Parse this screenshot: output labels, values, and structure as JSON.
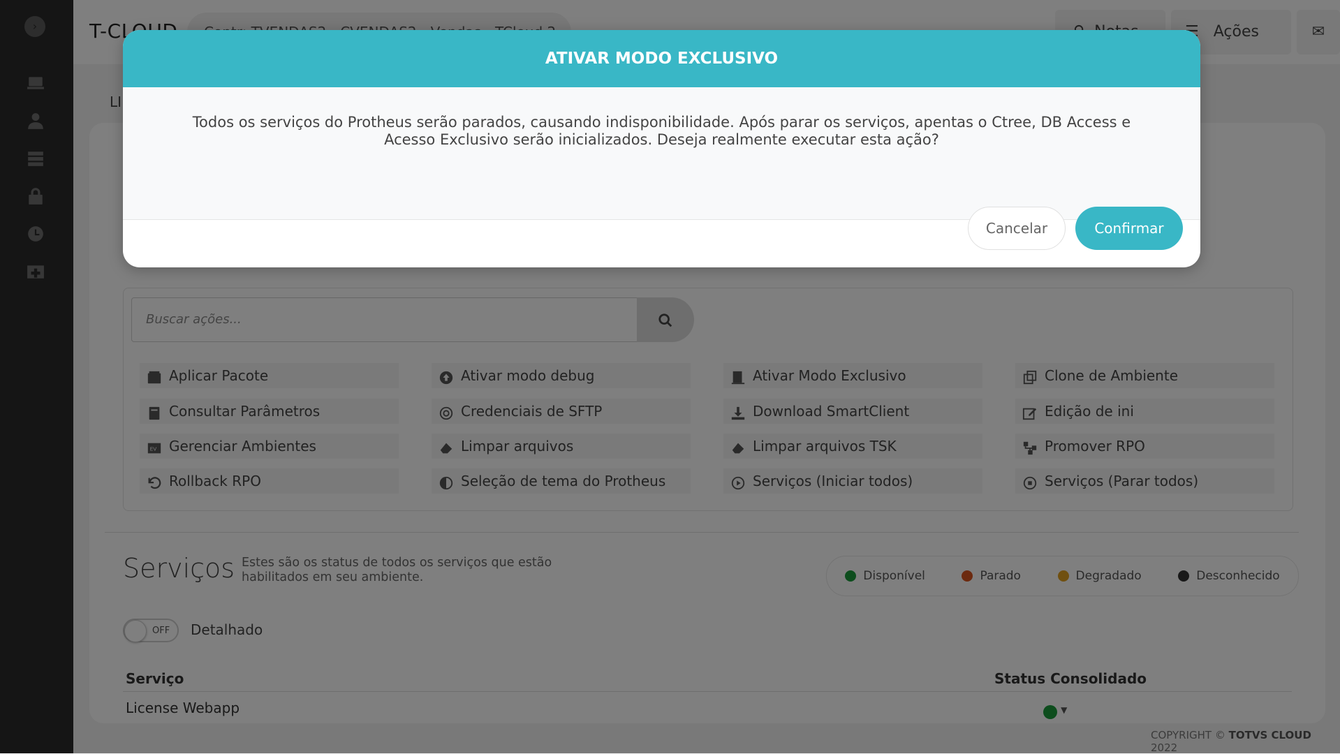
{
  "brand": "T-CLOUD",
  "breadcrumb": "Contr: TVENDAS2 - CVENDAS2 - Vendas - TCloud 2",
  "topbar": {
    "notes_label": "Notas",
    "actions_label": "Ações"
  },
  "content_tab": "LI",
  "search": {
    "placeholder": "Buscar ações..."
  },
  "actions": [
    {
      "label": "Aplicar Pacote",
      "icon": "package-icon"
    },
    {
      "label": "Ativar modo debug",
      "icon": "arrow-up-circle-icon"
    },
    {
      "label": "Ativar Modo Exclusivo",
      "icon": "door-icon"
    },
    {
      "label": "Clone de Ambiente",
      "icon": "clone-icon"
    },
    {
      "label": "Consultar Parâmetros",
      "icon": "book-icon"
    },
    {
      "label": "Credenciais de SFTP",
      "icon": "copyright-icon"
    },
    {
      "label": "Download SmartClient",
      "icon": "download-icon"
    },
    {
      "label": "Edição de ini",
      "icon": "edit-icon"
    },
    {
      "label": "Gerenciar Ambientes",
      "icon": "env-icon"
    },
    {
      "label": "Limpar arquivos",
      "icon": "eraser-icon"
    },
    {
      "label": "Limpar arquivos TSK",
      "icon": "eraser-icon"
    },
    {
      "label": "Promover RPO",
      "icon": "sitemap-icon"
    },
    {
      "label": "Rollback RPO",
      "icon": "undo-icon"
    },
    {
      "label": "Seleção de tema do Protheus",
      "icon": "adjust-icon"
    },
    {
      "label": "Serviços (Iniciar todos)",
      "icon": "play-circle-icon"
    },
    {
      "label": "Serviços (Parar todos)",
      "icon": "stop-circle-icon"
    }
  ],
  "services": {
    "title": "Serviços",
    "description": "Estes são os status de todos os serviços que estão habilitados em seu ambiente.",
    "legend": [
      {
        "label": "Disponível",
        "color": "#1a9b3a"
      },
      {
        "label": "Parado",
        "color": "#d9541e"
      },
      {
        "label": "Degradado",
        "color": "#e0a020"
      },
      {
        "label": "Desconhecido",
        "color": "#333333"
      }
    ],
    "toggle_state": "OFF",
    "toggle_label": "Detalhado",
    "columns": [
      "Serviço",
      "Status Consolidado"
    ],
    "rows": [
      {
        "name": "License Webapp",
        "status_color": "#1a9b3a"
      }
    ]
  },
  "footer": {
    "prefix": "COPYRIGHT ©",
    "brand": "TOTVS CLOUD",
    "year": "2022"
  },
  "modal": {
    "title": "ATIVAR MODO EXCLUSIVO",
    "message": "Todos os serviços do Protheus serão parados, causando indisponibilidade. Após parar os serviços, apentas o Ctree, DB Access e Acesso Exclusivo serão inicializados. Deseja realmente executar esta ação?",
    "cancel_label": "Cancelar",
    "confirm_label": "Confirmar"
  }
}
